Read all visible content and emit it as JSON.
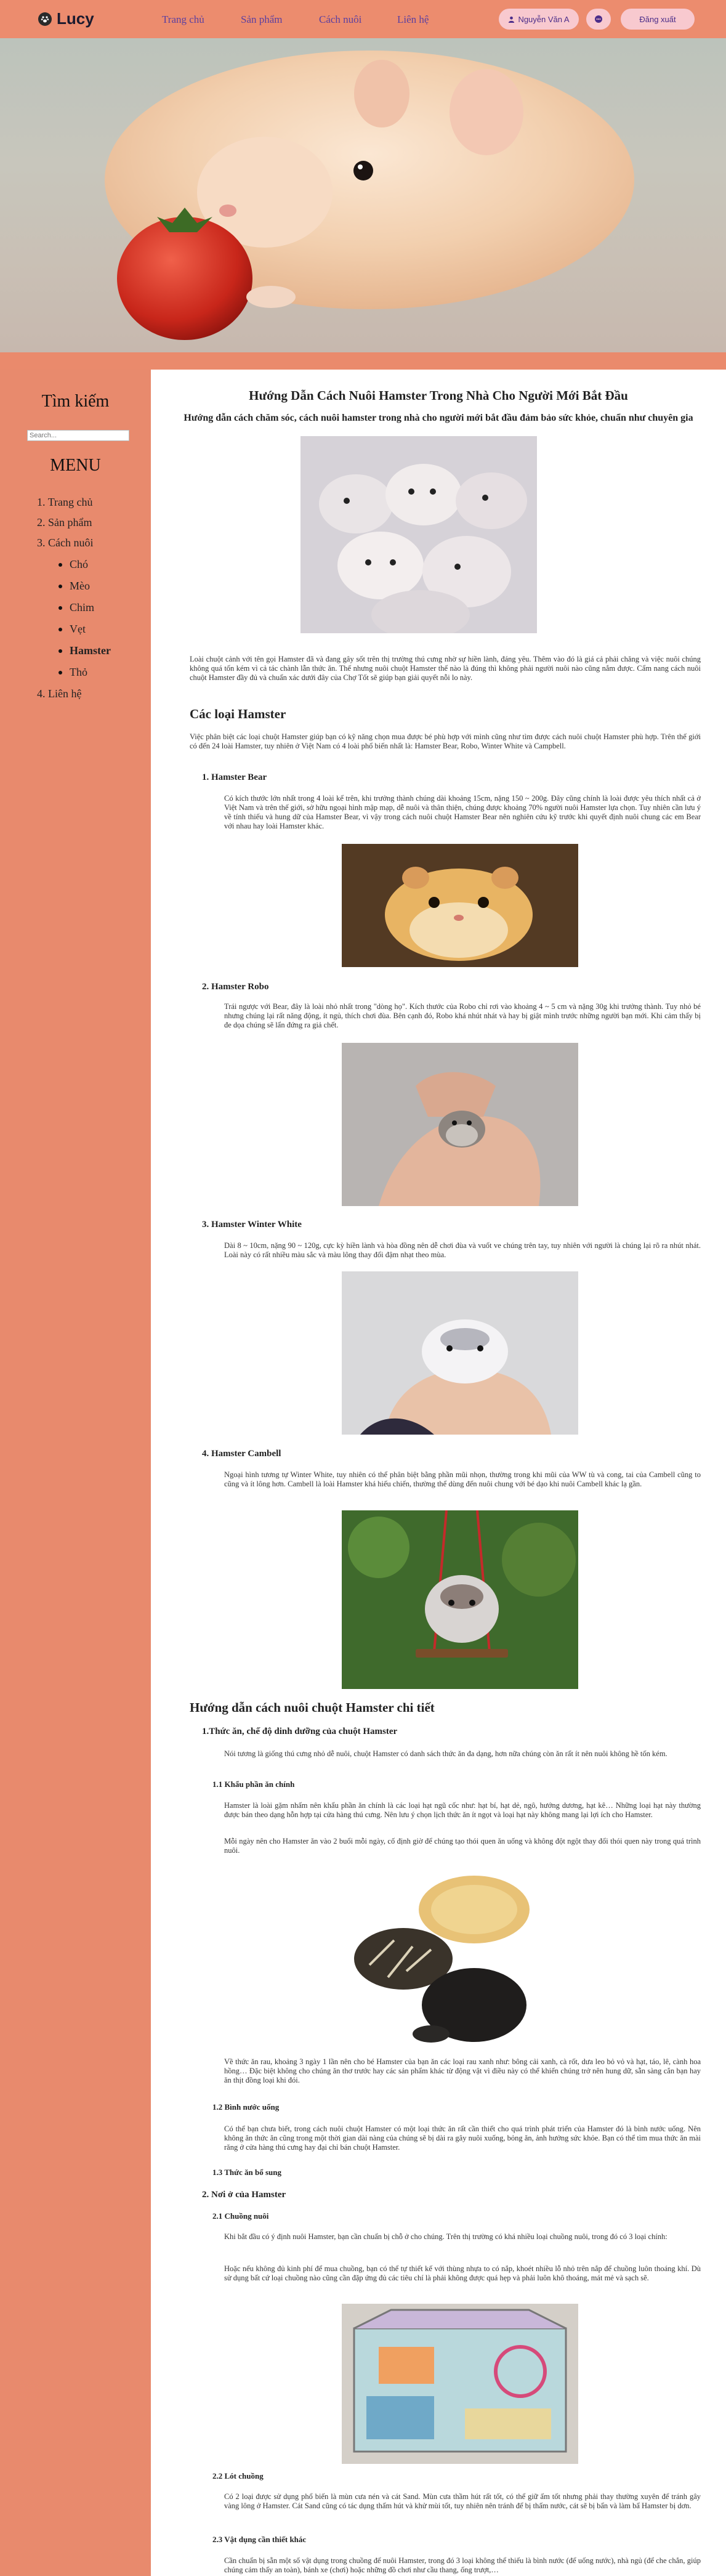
{
  "header": {
    "logo_text": "Lucy",
    "nav": [
      "Trang chủ",
      "Sản phẩm",
      "Cách nuôi",
      "Liên hệ"
    ],
    "user_label": "Nguyễn Văn A",
    "logout_label": "Đăng xuất",
    "colors": {
      "bar": "#ec8c6e",
      "pill": "#f8c9cf",
      "nav_text": "#5b3fa0"
    }
  },
  "sidebar": {
    "search_title": "Tìm kiếm",
    "search_placeholder": "Search...",
    "menu_title": "MENU",
    "menu": [
      {
        "num": "1.",
        "label": "Trang chủ"
      },
      {
        "num": "2.",
        "label": "Sản phẩm"
      },
      {
        "num": "3.",
        "label": "Cách nuôi"
      },
      {
        "num": "4.",
        "label": "Liên hệ"
      }
    ],
    "submenu": [
      "Chó",
      "Mèo",
      "Chim",
      "Vẹt",
      "Hamster",
      "Thỏ"
    ],
    "active_submenu": "Hamster"
  },
  "article": {
    "title": "Hướng Dẫn Cách Nuôi Hamster Trong Nhà Cho Người Mới Bắt Đầu",
    "subtitle": "Hướng dẫn cách chăm sóc, cách nuôi hamster trong nhà cho người mới bắt đầu đảm bảo sức khỏe, chuẩn như chuyên gia",
    "intro": "Loài chuột cảnh với tên gọi Hamster đã và đang gây sốt trên thị trường thú cưng nhờ sự hiền lành, đáng yêu. Thêm vào đó là giá cả phải chăng và việc nuôi chúng không quá tốn kém vì cả tác chành lẫn thức ăn. Thế nhưng nuôi chuột Hamster thế nào là đúng thì không phải người nuôi nào cũng nắm được. Cẩm nang cách nuôi chuột Hamster đầy đủ và chuẩn xác dưới đây của Chợ Tốt sẽ giúp bạn giải quyết nỗi lo này.",
    "types_heading": "Các loại Hamster",
    "types_intro": "Việc phân biệt các loại chuột Hamster giúp bạn có kỹ năng chọn mua được bé phù hợp với mình cũng như tìm được cách nuôi chuột Hamster phù hợp. Trên thế giới có đến 24 loài Hamster, tuy nhiên ở Việt Nam có 4 loài phổ biến nhất là: Hamster Bear, Robo, Winter White và Campbell.",
    "types": [
      {
        "heading": "1. Hamster Bear",
        "text": "Có kích thước lớn nhất trong 4 loài kể trên, khi trưởng thành chúng dài khoảng 15cm, nặng 150 ~ 200g. Đây cũng chính là loài được yêu thích nhất cả ở Việt Nam và trên thế giới, sở hữu ngoại hình mập mạp, dễ nuôi và thân thiện, chúng được khoảng 70% người nuôi Hamster lựa chọn. Tuy nhiên cần lưu ý về tính thiếu và hung dữ của Hamster Bear, vì vậy trong cách nuôi chuột Hamster Bear nên nghiên cứu kỹ trước khi quyết định nuôi chung các em Bear với nhau hay loài Hamster khác."
      },
      {
        "heading": "2. Hamster Robo",
        "text": "Trái ngược với Bear, đây là loài nhỏ nhất trong \"dòng họ\". Kích thước của Robo chỉ rơi vào khoảng 4 ~ 5 cm và nặng 30g khi trưởng thành. Tuy nhỏ bé nhưng chúng lại rất năng động, ít ngủ, thích chơi đùa. Bên cạnh đó, Robo khá nhút nhát và hay bị giật mình trước những người bạn mới. Khi cảm thấy bị đe dọa chúng sẽ lẩn đứng ra giả chết."
      },
      {
        "heading": "3. Hamster Winter White",
        "text": "Dài 8 ~ 10cm, nặng 90 ~ 120g, cực kỳ hiền lành và hòa đồng nên dễ chơi đùa và vuốt ve chúng trên tay, tuy nhiên với người là chúng lại rõ ra nhút nhát. Loài này có rất nhiều màu sắc và màu lông thay đổi đậm nhạt theo mùa."
      },
      {
        "heading": "4. Hamster Cambell",
        "text": "Ngoại hình tương tự Winter White, tuy nhiên có thể phân biệt bằng phần mũi nhọn, thường trong khi mũi của WW tù và cong, tai của Cambell cũng to cũng và ít lông hơn. Cambell là loài Hamster khá hiếu chiến, thường thể dùng đến nuôi chung với bé dạo khi nuôi Cambell khác lạ gần."
      }
    ],
    "guide_heading": "Hướng dẫn cách nuôi chuột Hamster chi tiết",
    "g1_heading": "1.Thức ăn, chế độ dinh dưỡng của chuột Hamster",
    "g1_text": "Nói tương là giống thú cưng nhỏ dễ nuôi, chuột Hamster có danh sách thức ăn đa dạng, hơn nữa chúng còn ăn rất ít nên nuôi không hề tốn kém.",
    "g11_heading": "1.1 Khẩu phần ăn chính",
    "g11_text1": "Hamster là loài gặm nhấm nên khẩu phần ăn chính là các loại hạt ngũ cốc như: hạt bí, hạt dẻ, ngô, hướng dương, hạt kê… Những loại hạt này thường được bán theo dạng hỗn hợp tại cửa hàng thú cưng. Nên lưu ý chọn lịch thức ăn ít ngọt và loại hạt này không mang lại lợi ích cho Hamster.",
    "g11_text2": "Mỗi ngày nên cho Hamster ăn vào 2 buổi mỗi ngày, cố định giờ để chúng tạo thói quen ăn uống và không đột ngột thay đổi thói quen này trong quá trình nuôi.",
    "g11_text3": "Về thức ăn rau, khoảng 3 ngày 1 lần nên cho bé Hamster của bạn ăn các loại rau xanh như: bông cải xanh, cà rốt, dưa leo bỏ vỏ và hạt, táo, lê, cành hoa hồng… Đặc biệt không cho chúng ăn thơ trước hay các sản phẩm khác từ động vật vì điều này có thể khiến chúng trở nên hung dữ, sẵn sàng cắn bạn hay ăn thịt đồng loại khi đói.",
    "g12_heading": "1.2 Bình nước uống",
    "g12_text": "Có thể bạn chưa biết, trong cách nuôi chuột Hamster có một loại thức ăn rất cần thiết cho quá trình phát triển của Hamster đó là bình nước uống. Nên không ăn thức ăn cũng trong một thời gian dài nàng của chúng sẽ bị dài ra gây nuôi xuống, bỏng ăn, ảnh hưởng sức khỏe. Bạn có thể tìm mua thức ăn mài răng ở cửa hàng thú cưng hay đại chỉ bán chuột Hamster.",
    "g13_heading": "1.3 Thức ăn bổ sung",
    "g2_heading": "2. Nơi ở của Hamster",
    "g21_heading": "2.1 Chuồng nuôi",
    "g21_text1": "Khi bắt đầu có ý định nuôi Hamster, bạn cần chuẩn bị chỗ ở cho chúng. Trên thị trường có khá nhiều loại chuồng nuôi, trong đó có 3 loại chính:",
    "g21_text2": "Hoặc nếu không đủ kinh phí để mua chuồng, bạn có thể tự thiết kế với thùng nhựa to có nắp, khoét nhiều lỗ nhỏ trên nắp để chuồng luôn thoáng khí. Dù sử dụng bất cứ loại chuồng nào cũng cần đặp ứng đủ các tiêu chí là phải không được quá hẹp và phải luôn khô thoáng, mát mẻ và sạch sẽ.",
    "g22_heading": "2.2 Lót chuồng",
    "g22_text": "Có 2 loại được sử dụng phổ biến là mùn cưa nén và cát Sand. Mùn cưa thầm hút rất tốt, có thể giữ ấm tốt nhưng phải thay thường xuyên để tránh gây vàng lông ở Hamster. Cát Sand cũng có tác dụng thấm hút và khử mùi tốt, tuy nhiên nên tránh để bị thấm nước, cát sẽ bị bẩn và làm bẩ Hamster bị dơn.",
    "g23_heading": "2.3 Vật dụng cần thiết khác",
    "g23_text": "Cần chuẩn bị sẵn một số vật dụng trong chuồng để nuôi Hamster, trong đó 3 loại không thể thiếu là bình nước (để uống nước), nhà ngủ (để che chắn, giúp chúng cảm thấy an toàn), bánh xe (chơi) hoặc những đồ chơi như cầu thang, ống trượt,…"
  }
}
